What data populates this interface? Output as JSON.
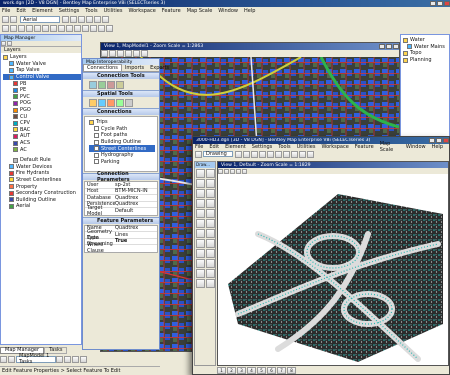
{
  "main_window": {
    "title": "work.dgn [2D - V8 DGN] - Bentley Map Enterprise V8i (SELECTseries 3)",
    "menu": [
      "File",
      "Edit",
      "Element",
      "Settings",
      "Tools",
      "Utilities",
      "Workspace",
      "Feature",
      "Map Scale",
      "Window",
      "Help"
    ],
    "level_value": "Aerial"
  },
  "map_manager": {
    "title": "Map Manager",
    "tab": "Layers",
    "items": [
      "Layers",
      "Water Valve",
      "Tap Valve",
      "Control Valve",
      "PB",
      "PE",
      "PVC",
      "POG",
      "PGO",
      "CU",
      "CPV",
      "BAC",
      "AUT",
      "ACS",
      "AC",
      "Default Rule",
      "Water Devices",
      "Fire Hydrants",
      "Street Centerlines",
      "Property",
      "Secondary Construction",
      "Building Outline",
      "Aerial"
    ]
  },
  "right_panel": {
    "items": [
      "Water",
      "Water Mains",
      "Topo",
      "Planning"
    ]
  },
  "map_interop": {
    "title": "Map Interoperability",
    "tabs": [
      "Connections",
      "Imports",
      "Exports"
    ],
    "sections": {
      "connection_tools": "Connection Tools",
      "spatial_tools": "Spatial Tools",
      "connections": "Connections",
      "connection_parameters": "Connection Parameters",
      "feature_parameters": "Feature Parameters"
    },
    "tree": [
      "Trips",
      "Cycle Path",
      "Foot paths",
      "Building Outline",
      "Street Centerlines",
      "Hydrography",
      "Parking"
    ],
    "conn_params": [
      [
        "User",
        "sp-2st"
      ],
      [
        "Host",
        "BTM-MICN-IN"
      ],
      [
        "Database",
        "Quadtrex"
      ],
      [
        "Persistence Locker",
        "Quadtrex"
      ],
      [
        "Target Model",
        "Default"
      ]
    ],
    "feat_params": [
      [
        "Name",
        "Quadtrex"
      ],
      [
        "Geometry Type",
        "Lines"
      ],
      [
        "Data Streaming",
        "True"
      ],
      [
        "Where Clause",
        ""
      ]
    ]
  },
  "view1": {
    "title": "View 1, MapModel1 - Zoom Scale = 1:2863"
  },
  "second_window": {
    "title": "3000-HD3.dgn [3D - V8 DGN] - Bentley Map Enterprise V8i (SELECTseries 3)",
    "menu": [
      "File",
      "Edit",
      "Element",
      "Settings",
      "Tools",
      "Utilities",
      "Workspace",
      "Feature",
      "Map Scale",
      "Window",
      "Help"
    ],
    "level_value": "Drawing",
    "view_title": "View 1, Default - Zoom Scale = 1:1829",
    "palette_header": "Draw...",
    "bottom_views": [
      "1",
      "2",
      "3",
      "4",
      "5",
      "6",
      "7",
      "8"
    ]
  },
  "bottom_tabs": [
    "Map Manager",
    "Tasks"
  ],
  "model_select": "MapModel 1 Tasks",
  "status": "Edit Feature Properties > Select Feature To Edit",
  "colors": {
    "titlebar": "#0a246a",
    "titlebar_light": "#a6caf0",
    "panel": "#ece9d8",
    "point_cloud": "#29b6b0"
  }
}
